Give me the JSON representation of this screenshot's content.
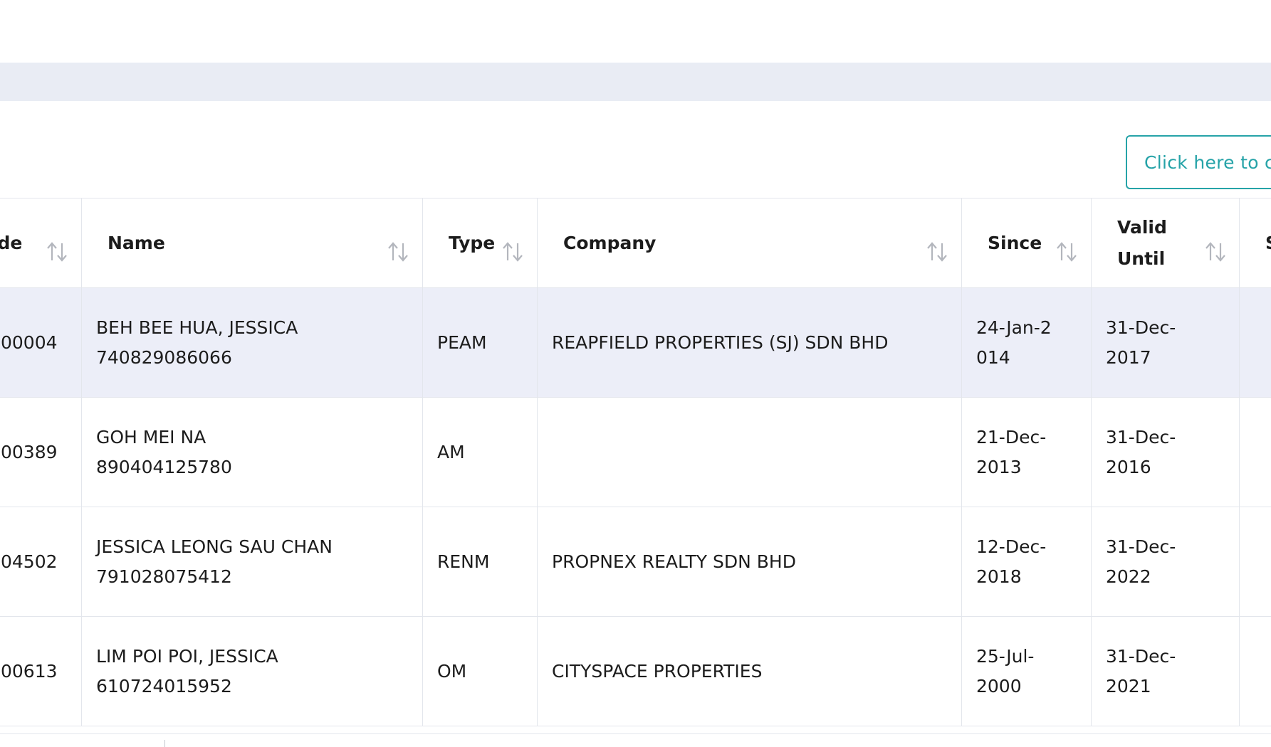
{
  "action_button": {
    "label": "Click here to c"
  },
  "table": {
    "columns": [
      {
        "label": "Code",
        "sortable": true
      },
      {
        "label": "Name",
        "sortable": true
      },
      {
        "label": "Type",
        "sortable": true
      },
      {
        "label": "Company",
        "sortable": true
      },
      {
        "label": "Since",
        "sortable": true
      },
      {
        "label": "Valid Until",
        "sortable": true
      },
      {
        "label": "S",
        "sortable": false
      }
    ],
    "rows": [
      {
        "code": "00004",
        "name": "BEH BEE HUA, JESSICA",
        "id_number": "740829086066",
        "type": "PEAM",
        "company": "REAPFIELD PROPERTIES (SJ) SDN BHD",
        "since": "24-Jan-2014",
        "valid_until": "31-Dec-2017",
        "selected": true
      },
      {
        "code": "00389",
        "name": "GOH MEI NA",
        "id_number": "890404125780",
        "type": "AM",
        "company": "",
        "since": "21-Dec-2013",
        "valid_until": "31-Dec-2016",
        "selected": false
      },
      {
        "code": "04502",
        "name": "JESSICA LEONG SAU CHAN",
        "id_number": "791028075412",
        "type": "RENM",
        "company": "PROPNEX REALTY SDN BHD",
        "since": "12-Dec-2018",
        "valid_until": "31-Dec-2022",
        "selected": false
      },
      {
        "code": "00613",
        "name": "LIM POI POI, JESSICA",
        "id_number": "610724015952",
        "type": "OM",
        "company": "CITYSPACE PROPERTIES",
        "since": "25-Jul-2000",
        "valid_until": "31-Dec-2021",
        "selected": false
      }
    ]
  },
  "colors": {
    "accent": "#26a3a8",
    "band": "#e9ecf4",
    "selected_row": "#eceef8",
    "border": "#e3e6ec",
    "sort_icon": "#b3b6bd"
  }
}
